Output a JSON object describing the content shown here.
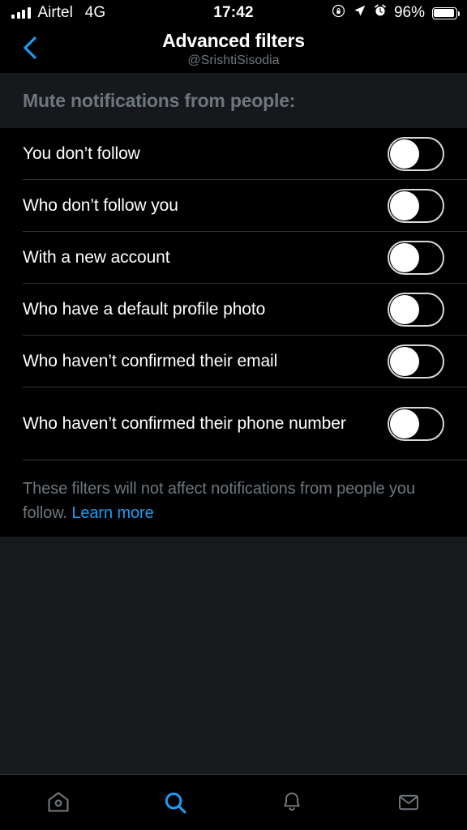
{
  "status_bar": {
    "signal_icon": "signal-bars-icon",
    "carrier": "Airtel",
    "network": "4G",
    "time": "17:42",
    "rotation_lock_icon": "rotation-lock-icon",
    "location_icon": "location-arrow-icon",
    "alarm_icon": "alarm-clock-icon",
    "battery_percent": "96%",
    "battery_icon": "battery-icon"
  },
  "nav": {
    "back_icon": "chevron-left-icon",
    "title": "Advanced filters",
    "subtitle": "@SrishtiSisodia"
  },
  "section": {
    "header": "Mute notifications from people:"
  },
  "settings": {
    "rows": [
      {
        "label": "You don’t follow",
        "state": "off"
      },
      {
        "label": "Who don’t follow you",
        "state": "off"
      },
      {
        "label": "With a new account",
        "state": "off"
      },
      {
        "label": "Who have a default profile photo",
        "state": "off"
      },
      {
        "label": "Who haven’t confirmed their email",
        "state": "off"
      },
      {
        "label": "Who haven’t confirmed their phone number",
        "state": "off"
      }
    ]
  },
  "footnote": {
    "text": "These filters will not affect notifications from people you follow. ",
    "link": "Learn more"
  },
  "tabbar": {
    "items": [
      {
        "name": "home-icon",
        "label": "Home",
        "active": false
      },
      {
        "name": "search-icon",
        "label": "Search",
        "active": true
      },
      {
        "name": "bell-icon",
        "label": "Notifications",
        "active": false
      },
      {
        "name": "envelope-icon",
        "label": "Messages",
        "active": false
      }
    ]
  },
  "colors": {
    "accent": "#1d9bf0",
    "background": "#000000",
    "panel_header": "#16181c",
    "page_background": "#17191c",
    "secondary_text": "#6e767d",
    "divider": "#2f3336"
  }
}
